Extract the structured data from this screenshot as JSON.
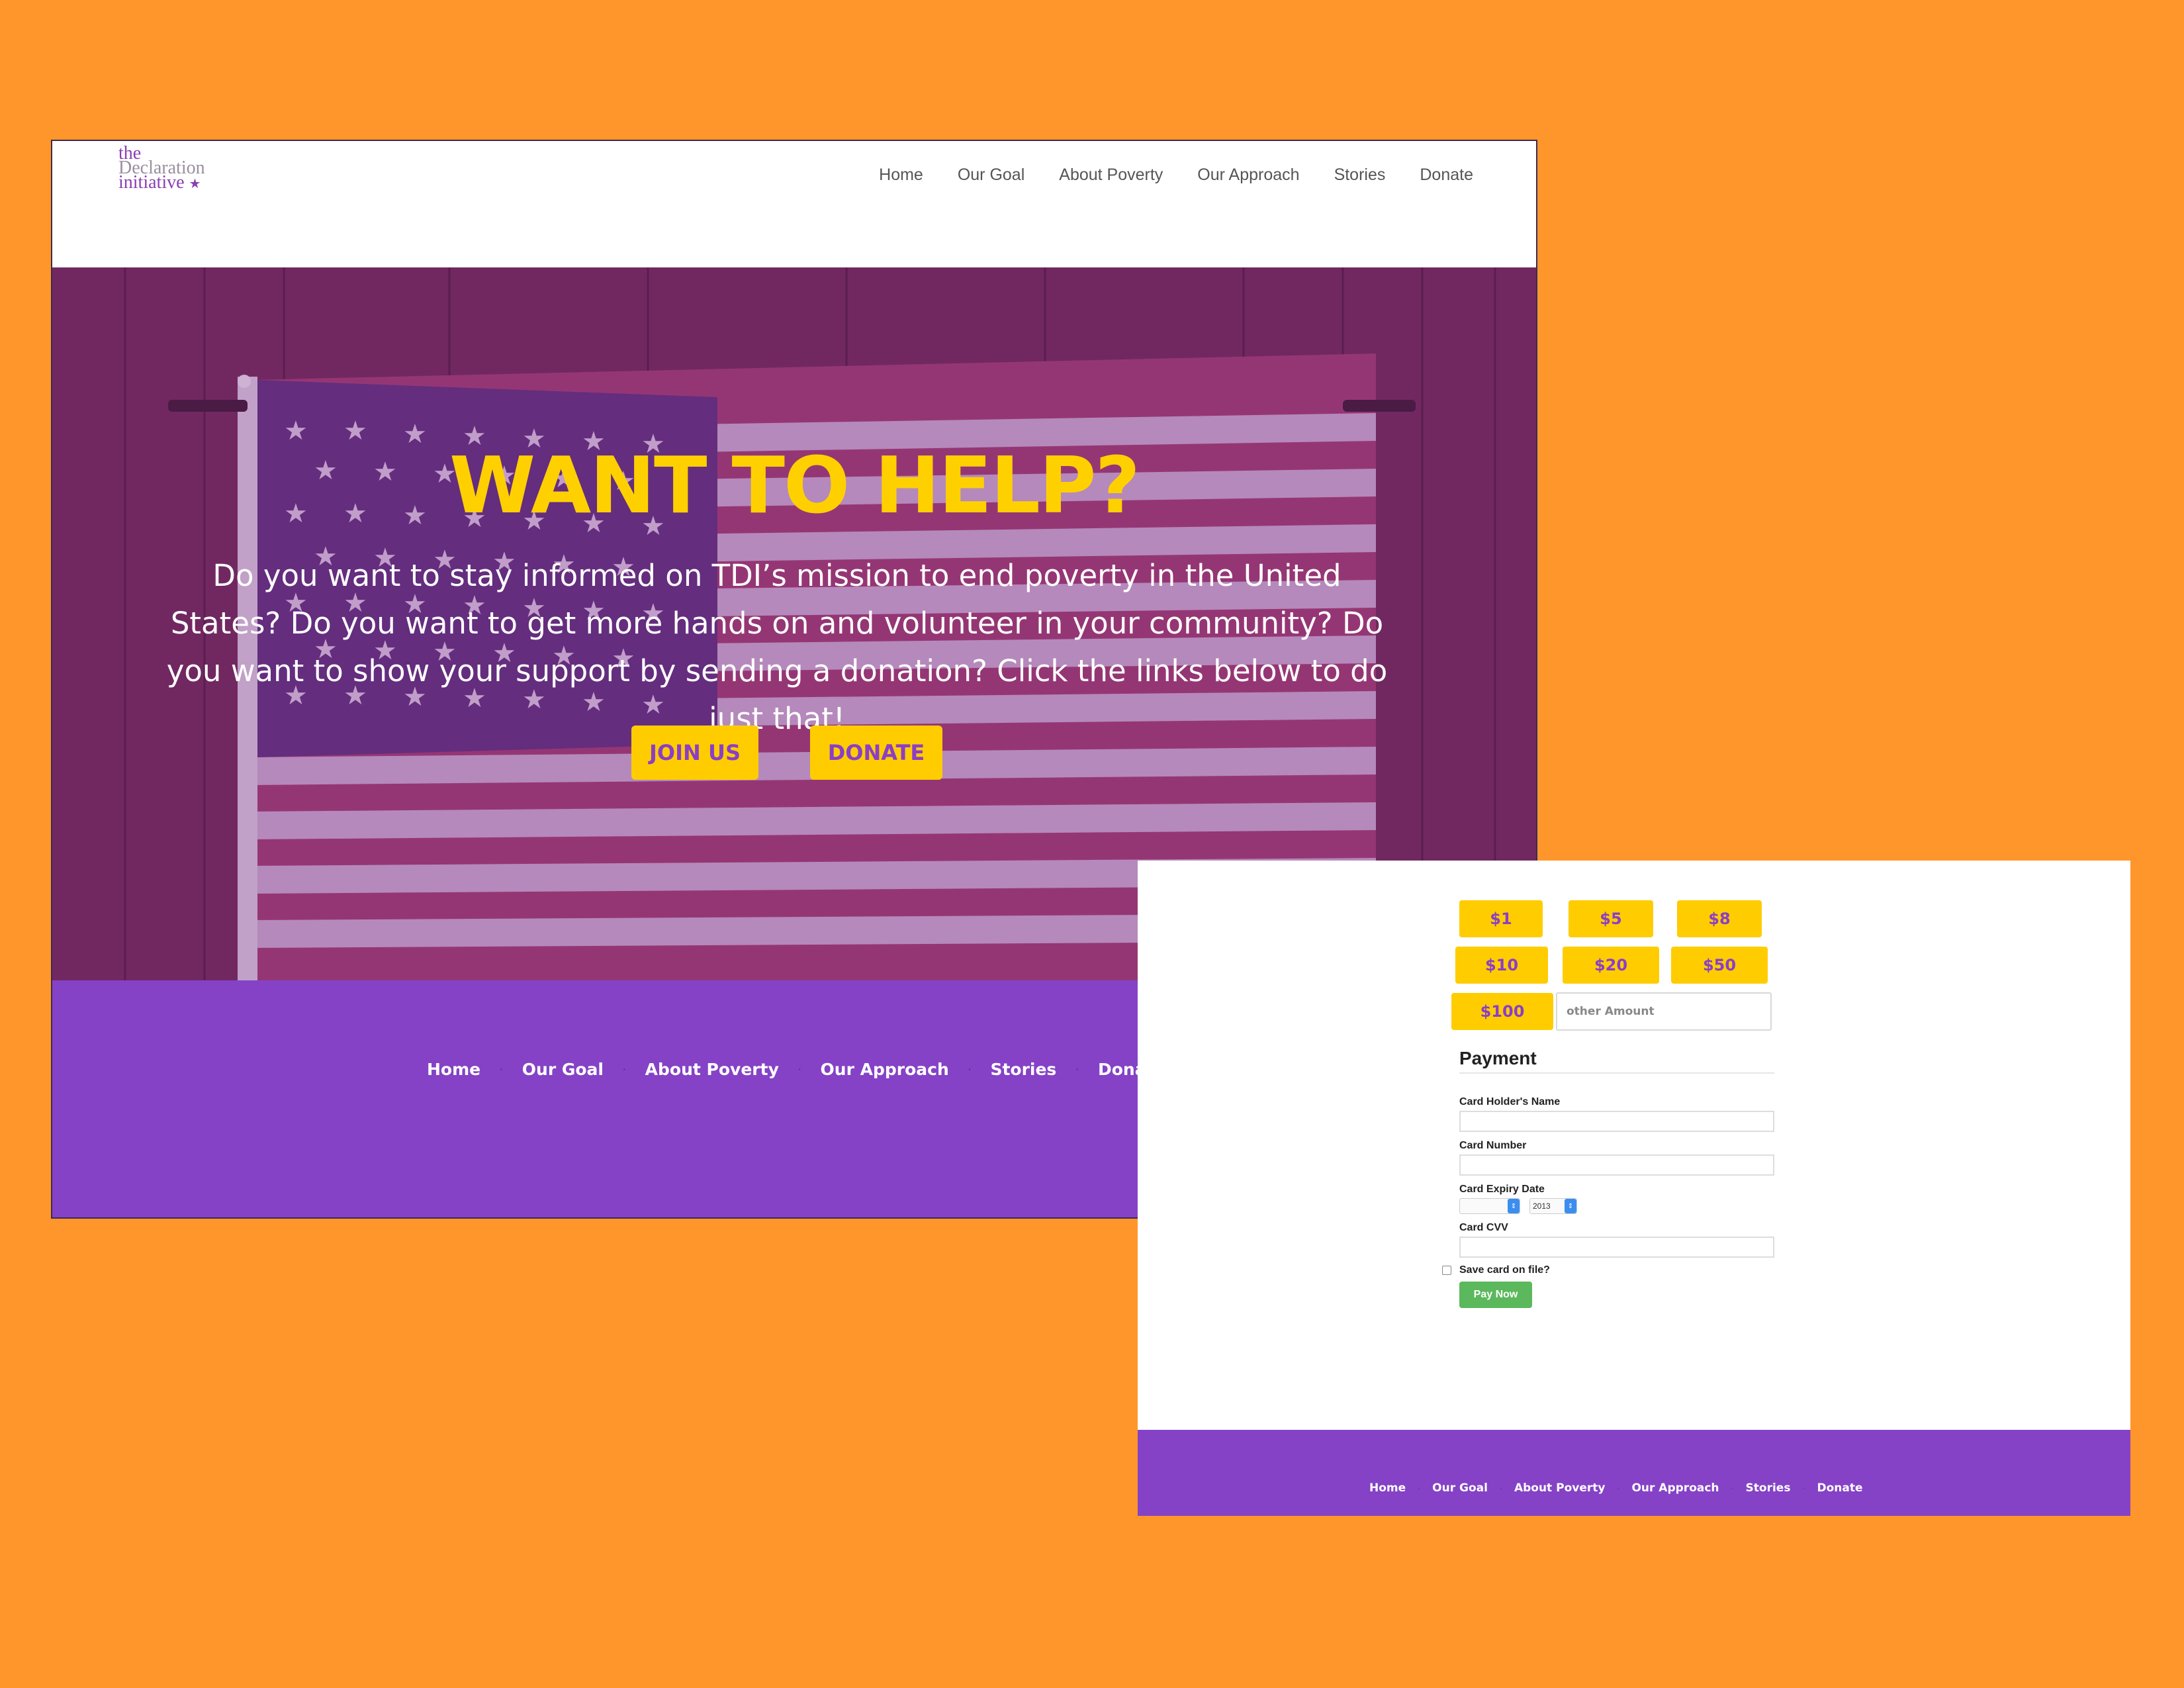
{
  "colors": {
    "background": "#FF962B",
    "purple": "#8542C6",
    "yellow": "#FFCC00",
    "title_yellow": "#FFD000",
    "green": "#5CB85C"
  },
  "header": {
    "logo": {
      "line1": "the",
      "line2": "Declaration",
      "line3": "initiative",
      "star": "★"
    },
    "nav": [
      "Home",
      "Our Goal",
      "About Poverty",
      "Our Approach",
      "Stories",
      "Donate"
    ]
  },
  "hero": {
    "title": "WANT TO HELP?",
    "text": "Do you want to stay informed on TDI’s mission to end poverty in the United States? Do you want to get more hands on and volunteer in your community? Do you want to show your support by sending a donation? Click the links below to do just that!",
    "join_label": "JOIN US",
    "donate_label": "DONATE"
  },
  "footer": {
    "nav": [
      "Home",
      "Our Goal",
      "About Poverty",
      "Our Approach",
      "Stories",
      "Donate"
    ],
    "separator": "·"
  },
  "donate_form": {
    "amounts": [
      "$1",
      "$5",
      "$8",
      "$10",
      "$20",
      "$50",
      "$100"
    ],
    "other_placeholder": "other Amount",
    "payment_title": "Payment",
    "card_holder_label": "Card Holder's Name",
    "card_number_label": "Card Number",
    "card_expiry_label": "Card Expiry Date",
    "expiry_month_value": "",
    "expiry_year_value": "2013",
    "card_cvv_label": "Card CVV",
    "save_card_label": "Save card on file?",
    "pay_now_label": "Pay Now"
  }
}
